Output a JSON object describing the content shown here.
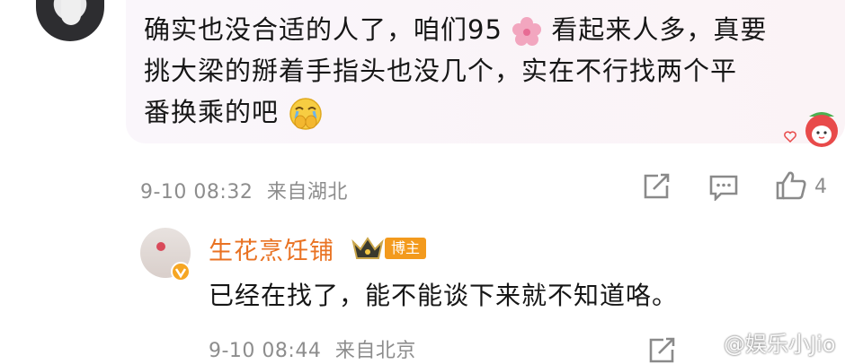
{
  "comment": {
    "lines": [
      "确实也没合适的人了，咱们95",
      "看起来人多，真要",
      "挑大梁的掰着手指头也没几个，实在不行找两个平",
      "番换乘的吧"
    ],
    "flower_icon": "cherry-blossom-emoji",
    "emoji_icon": "crying-hands-over-mouth-emoji",
    "time": "9-10 08:32",
    "location": "来自湖北",
    "like_count": "4"
  },
  "reply": {
    "author": "生花烹饪铺",
    "badge": "博主",
    "text": "已经在找了，能不能谈下来就不知道咯。",
    "time": "9-10 08:44",
    "location": "来自北京"
  },
  "watermark": "@娱乐小Jio",
  "colors": {
    "author": "#e97222",
    "meta": "#8d8d8d",
    "badge": "#f39a1d"
  }
}
